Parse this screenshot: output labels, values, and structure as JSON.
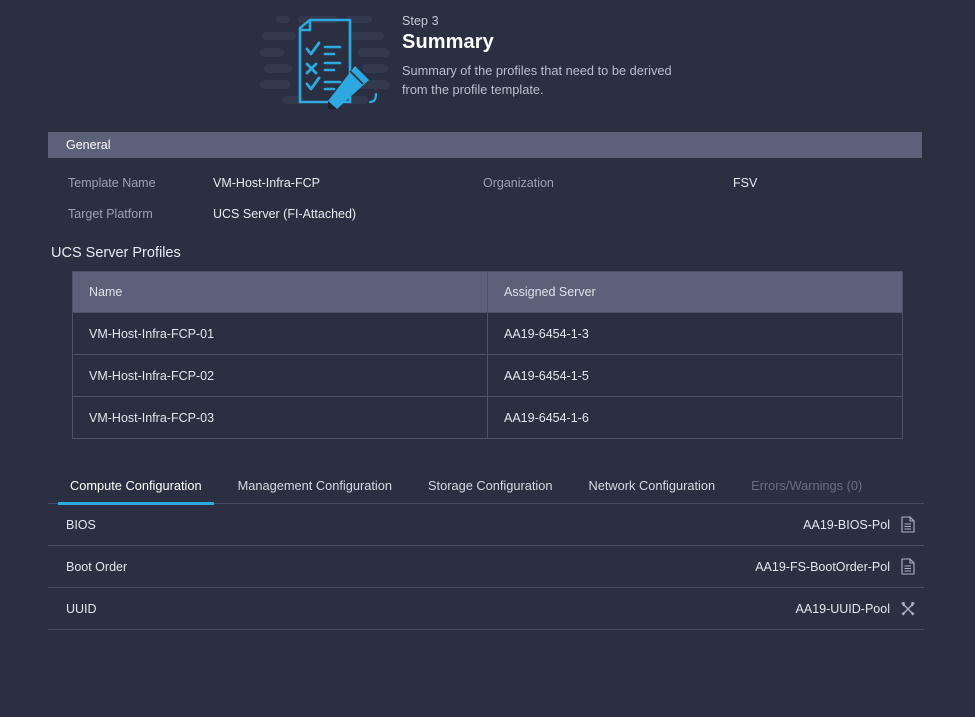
{
  "hero": {
    "step_label": "Step 3",
    "title": "Summary",
    "description": "Summary of the profiles that need to be derived from the profile template.",
    "illustration_icon": "checklist-document-pencil-illustration",
    "accent_color": "#2ea8e0"
  },
  "general": {
    "section_title": "General",
    "fields": [
      {
        "key": "Template Name",
        "value": "VM-Host-Infra-FCP"
      },
      {
        "key": "Organization",
        "value": "FSV"
      },
      {
        "key": "Target Platform",
        "value": "UCS Server (FI-Attached)"
      }
    ]
  },
  "profiles": {
    "title": "UCS Server Profiles",
    "columns": [
      "Name",
      "Assigned Server"
    ],
    "rows": [
      {
        "name": "VM-Host-Infra-FCP-01",
        "server": "AA19-6454-1-3"
      },
      {
        "name": "VM-Host-Infra-FCP-02",
        "server": "AA19-6454-1-5"
      },
      {
        "name": "VM-Host-Infra-FCP-03",
        "server": "AA19-6454-1-6"
      }
    ]
  },
  "tabs": [
    {
      "label": "Compute Configuration",
      "state": "active"
    },
    {
      "label": "Management Configuration",
      "state": "normal"
    },
    {
      "label": "Storage Configuration",
      "state": "normal"
    },
    {
      "label": "Network Configuration",
      "state": "normal"
    },
    {
      "label": "Errors/Warnings (0)",
      "state": "disabled"
    }
  ],
  "policies": [
    {
      "label": "BIOS",
      "value": "AA19-BIOS-Pol",
      "icon": "policy-document-icon"
    },
    {
      "label": "Boot Order",
      "value": "AA19-FS-BootOrder-Pol",
      "icon": "policy-document-icon"
    },
    {
      "label": "UUID",
      "value": "AA19-UUID-Pool",
      "icon": "pool-tools-icon"
    }
  ],
  "colors": {
    "background": "#2a3042",
    "header_bar": "#5b6178",
    "accent": "#2ea8e0",
    "divider": "#474d61"
  }
}
